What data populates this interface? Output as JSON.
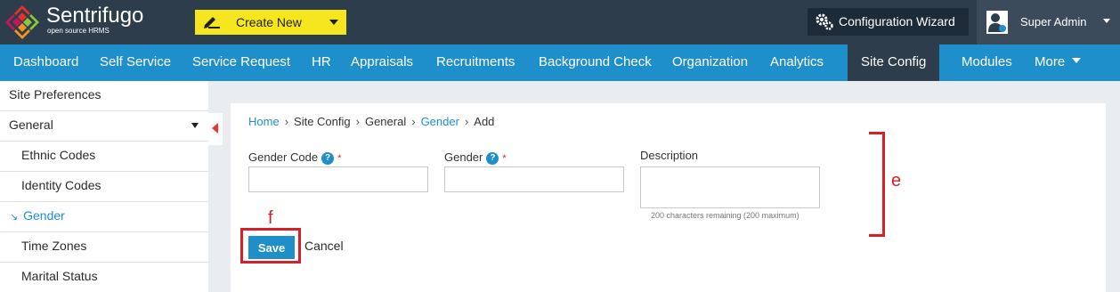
{
  "header": {
    "brand_name": "Sentrifugo",
    "brand_tagline": "open source HRMS",
    "create_new_label": "Create New",
    "configuration_wizard_label": "Configuration Wizard",
    "user_name": "Super Admin"
  },
  "nav": {
    "items": [
      {
        "label": "Dashboard"
      },
      {
        "label": "Self Service"
      },
      {
        "label": "Service Request"
      },
      {
        "label": "HR"
      },
      {
        "label": "Appraisals"
      },
      {
        "label": "Recruitments"
      },
      {
        "label": "Background Check"
      },
      {
        "label": "Organization"
      },
      {
        "label": "Analytics"
      },
      {
        "label": "Site Config",
        "active": true
      },
      {
        "label": "Modules"
      },
      {
        "label": "More"
      }
    ]
  },
  "sidebar": {
    "items": [
      {
        "label": "Site Preferences"
      },
      {
        "label": "General"
      },
      {
        "label": "Ethnic Codes"
      },
      {
        "label": "Identity Codes"
      },
      {
        "label": "Gender",
        "active": true
      },
      {
        "label": "Time Zones"
      },
      {
        "label": "Marital Status"
      }
    ]
  },
  "breadcrumb": {
    "home": "Home",
    "site_config": "Site Config",
    "general": "General",
    "gender": "Gender",
    "add": "Add",
    "separator": "›"
  },
  "form": {
    "gender_code_label": "Gender Code",
    "gender_code_value": "",
    "gender_label": "Gender",
    "gender_value": "",
    "description_label": "Description",
    "description_value": "",
    "required_marker": "*",
    "help_glyph": "?",
    "chars_remaining": "200 characters remaining (200 maximum)",
    "save_label": "Save",
    "cancel_label": "Cancel"
  },
  "annotations": {
    "bracket_label": "e",
    "box_label": "f",
    "color": "#d61f26"
  },
  "colors": {
    "header_bg": "#2e3d4c",
    "nav_bg": "#1f8fcc",
    "accent_yellow": "#f5e61f",
    "link_blue": "#1f8fcc"
  }
}
